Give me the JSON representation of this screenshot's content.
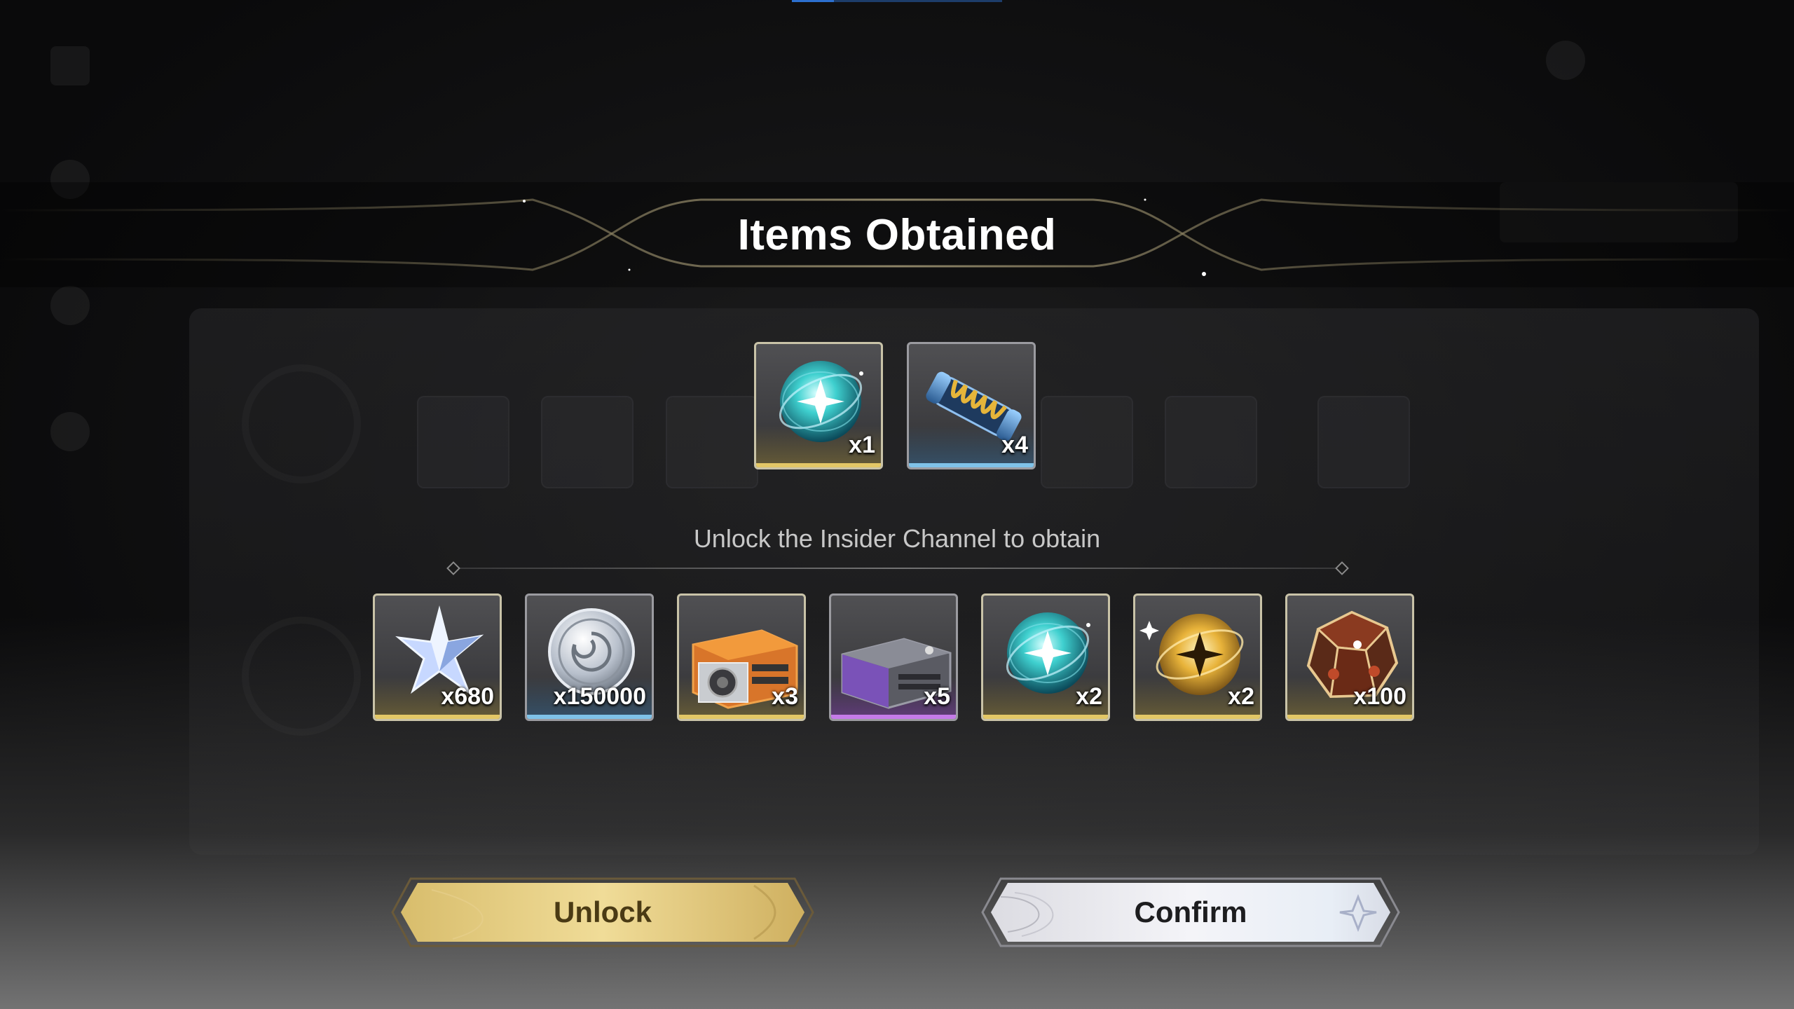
{
  "dialog": {
    "title": "Items Obtained",
    "subtitle": "Unlock the Insider Channel to obtain"
  },
  "obtained_items": [
    {
      "icon": "teal-orb-icon",
      "quantity": "x1",
      "rarity": "gold"
    },
    {
      "icon": "spring-capsule-icon",
      "quantity": "x4",
      "rarity": "blue"
    }
  ],
  "locked_items": [
    {
      "icon": "crystal-star-icon",
      "quantity": "x680",
      "rarity": "gold"
    },
    {
      "icon": "silver-coin-icon",
      "quantity": "x150000",
      "rarity": "blue"
    },
    {
      "icon": "orange-supply-crate-icon",
      "quantity": "x3",
      "rarity": "gold"
    },
    {
      "icon": "purple-supply-crate-icon",
      "quantity": "x5",
      "rarity": "purple"
    },
    {
      "icon": "teal-orb-icon",
      "quantity": "x2",
      "rarity": "gold"
    },
    {
      "icon": "golden-orb-icon",
      "quantity": "x2",
      "rarity": "gold"
    },
    {
      "icon": "amber-polyhedron-icon",
      "quantity": "x100",
      "rarity": "gold"
    }
  ],
  "buttons": {
    "unlock_label": "Unlock",
    "confirm_label": "Confirm"
  },
  "colors": {
    "gold_rarity": "#e3c766",
    "blue_rarity": "#7fc2e8",
    "purple_rarity": "#c57be8",
    "unlock_button": "#e8d28c",
    "confirm_button": "#e9e9ee"
  }
}
